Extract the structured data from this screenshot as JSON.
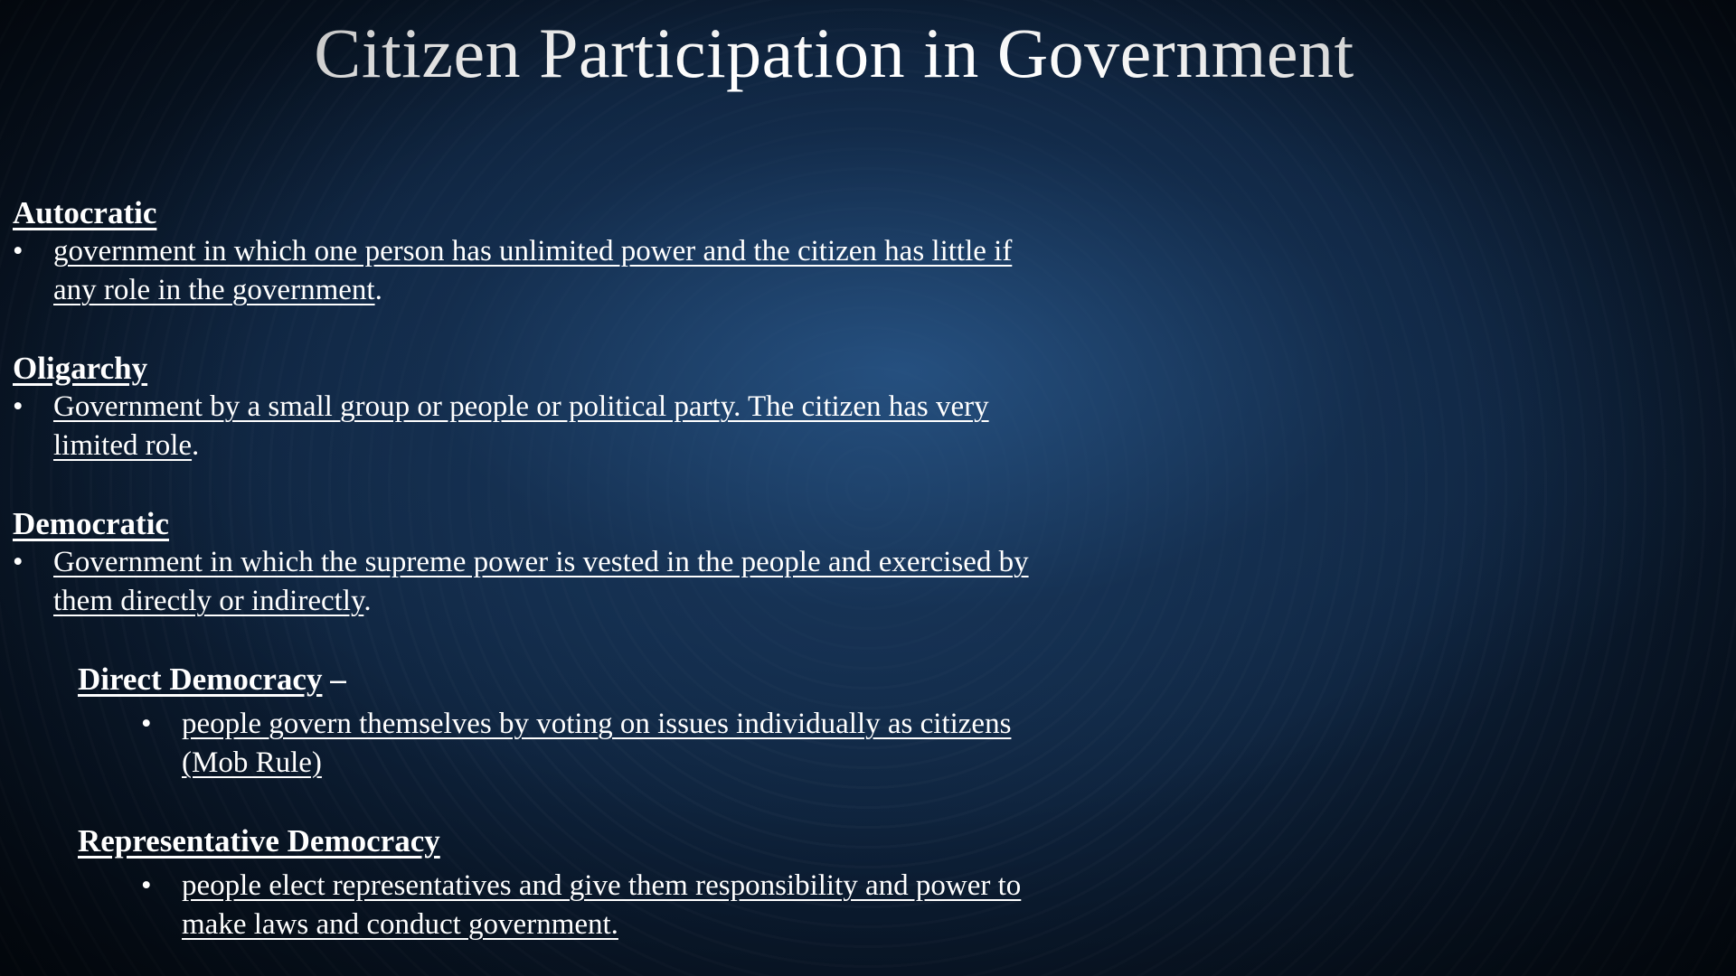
{
  "slide": {
    "title": "Citizen Participation in Government",
    "sections": [
      {
        "heading": "Autocratic",
        "bullet_line1": "government in which one person has unlimited power and the citizen has little if",
        "bullet_line2": "any role in the government",
        "bullet_tail": "."
      },
      {
        "heading": "Oligarchy",
        "bullet_line1": "Government by a small group or people or political party. The citizen has very",
        "bullet_line2": "limited role",
        "bullet_tail": "."
      },
      {
        "heading": "Democratic",
        "bullet_line1": "Government in which the supreme power is vested in the people and exercised by",
        "bullet_line2": "them directly or indirectly",
        "bullet_tail": "."
      }
    ],
    "subsections": [
      {
        "heading": "Direct Democracy",
        "suffix": " –",
        "bullet_line1": "people govern themselves by voting on issues individually as citizens",
        "bullet_line2": "(Mob  Rule)"
      },
      {
        "heading": "Representative Democracy",
        "suffix": "",
        "bullet_line1": "people elect representatives and give them responsibility and power to",
        "bullet_line2": "make laws and conduct government."
      }
    ],
    "bullet_glyph": "•",
    "colors": {
      "text": "#ffffff",
      "background_center": "#1a3a5e",
      "background_edge": "#050d18"
    }
  }
}
